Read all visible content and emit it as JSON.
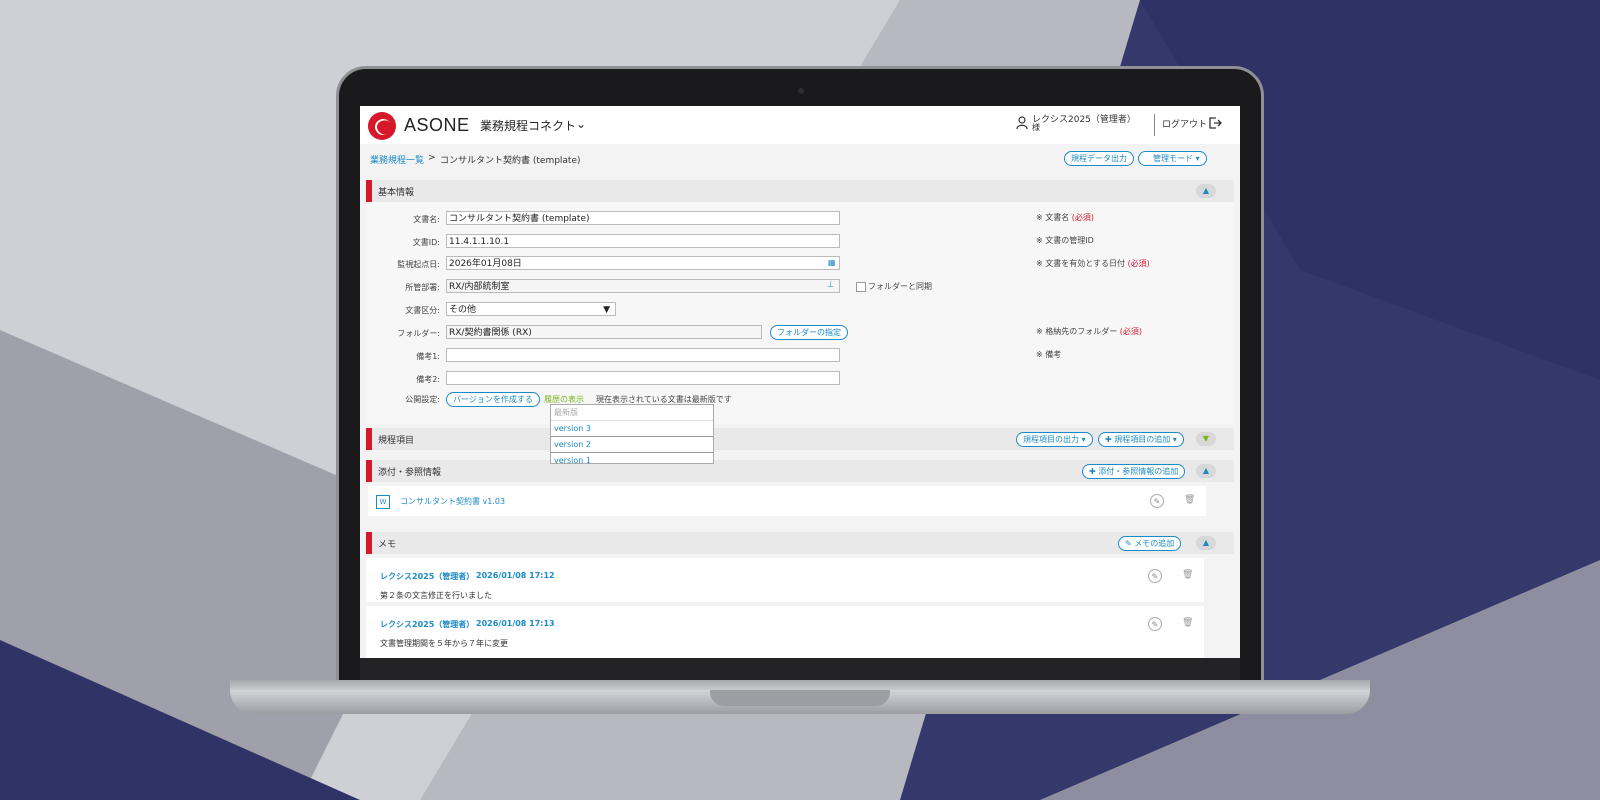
{
  "colors": {
    "accent": "#1a8ac8",
    "brand_red": "#d7182a"
  },
  "header": {
    "brand": "ASONE",
    "app_name": "業務規程コネクト",
    "user": "レクシス2025（管理者）",
    "user_suffix": "様",
    "logout": "ログアウト"
  },
  "breadcrumb": {
    "link": "業務規程一覧",
    "separator": ">",
    "current": "コンサルタント契約書 (template)"
  },
  "toolbar": {
    "export": "規程データ出力",
    "mode": "管理モード"
  },
  "basic": {
    "title": "基本情報",
    "fields": {
      "name_label": "文書名:",
      "name_value": "コンサルタント契約書 (template)",
      "id_label": "文書ID:",
      "id_value": "11.4.1.1.10.1",
      "start_label": "監視起点日:",
      "start_value": "2026年01月08日",
      "dept_label": "所管部署:",
      "dept_value": "RX/内部統制室",
      "category_label": "文書区分:",
      "category_value": "その他",
      "folder_label": "フォルダー:",
      "folder_value": "RX/契約書関係 (RX)",
      "note1_label": "備考1:",
      "note1_value": "",
      "note2_label": "備考2:",
      "note2_value": "",
      "publish_label": "公開設定:"
    },
    "sync_label": "フォルダーと同期",
    "folder_button": "フォルダーの指定",
    "version_button": "バージョンを作成する",
    "history_link": "履歴の表示",
    "current_note": "現在表示されている文書は最新版です",
    "notes": {
      "name": "※ 文書名",
      "name_req": "(必須)",
      "id": "※ 文書の管理ID",
      "date": "※ 文書を有効とする日付",
      "date_req": "(必須)",
      "folder": "※ 格納先のフォルダー",
      "folder_req": "(必須)",
      "remark": "※ 備考"
    },
    "versions": [
      "最新版",
      "version 3",
      "version 2",
      "version 1"
    ]
  },
  "items": {
    "title": "規程項目",
    "export": "規程項目の出力",
    "add": "規程項目の追加"
  },
  "attachments": {
    "title": "添付・参照情報",
    "add": "添付・参照情報の追加",
    "file": "コンサルタント契約書 v1.03"
  },
  "memo": {
    "title": "メモ",
    "add": "メモの追加",
    "entries": [
      {
        "user": "レクシス2025（管理者）",
        "date": "2026/01/08 17:12",
        "text": "第２条の文言修正を行いました"
      },
      {
        "user": "レクシス2025（管理者）",
        "date": "2026/01/08 17:13",
        "text": "文書管理期間を５年から７年に変更"
      }
    ]
  }
}
